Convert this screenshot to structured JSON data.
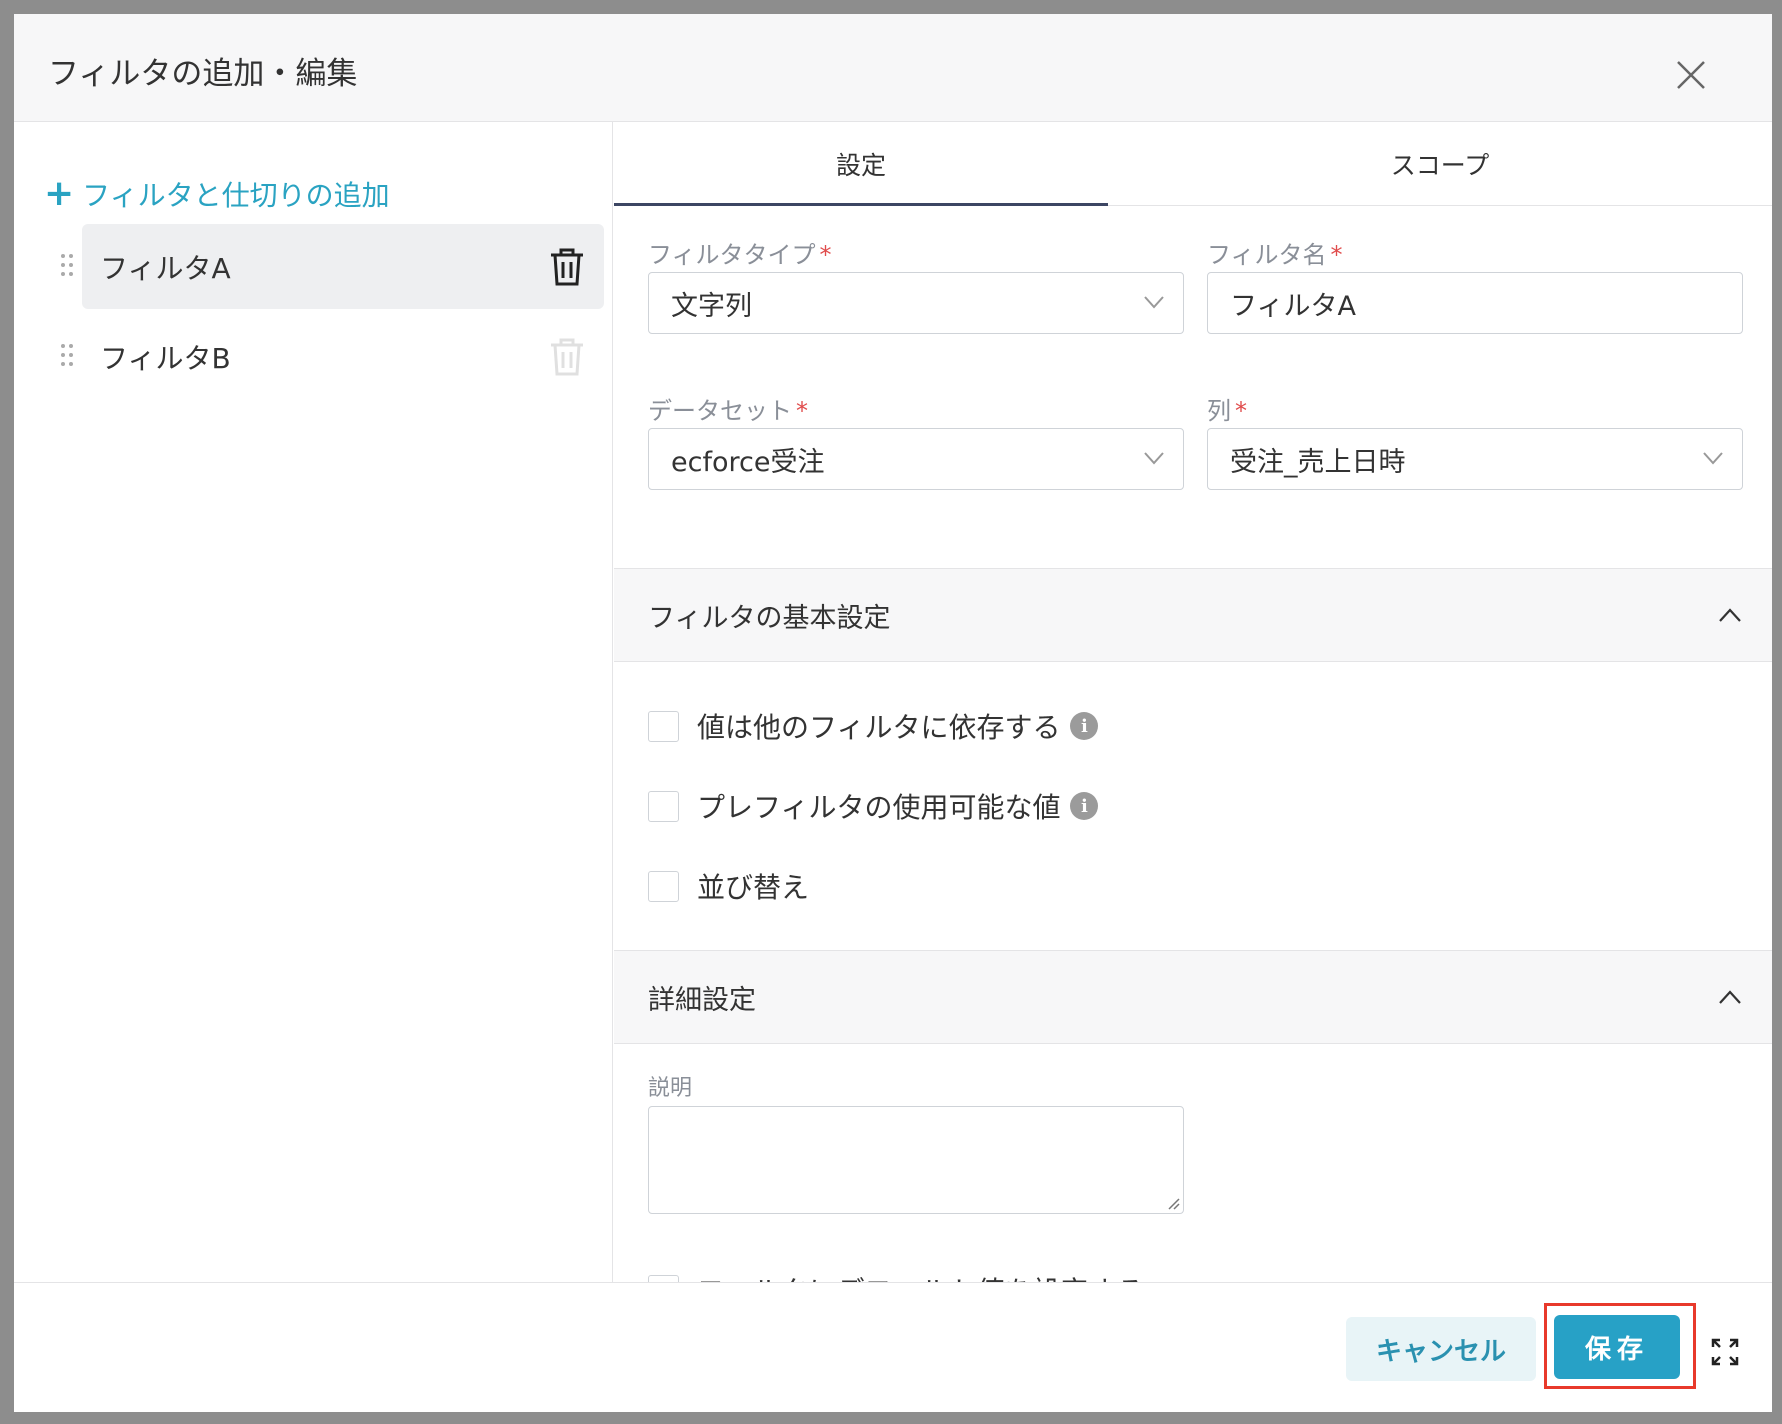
{
  "modal": {
    "title": "フィルタの追加・編集"
  },
  "left": {
    "add_label": "フィルタと仕切りの追加",
    "filters": [
      {
        "label": "フィルタA",
        "active": true
      },
      {
        "label": "フィルタB",
        "active": false
      }
    ]
  },
  "tabs": [
    {
      "label": "設定",
      "active": true
    },
    {
      "label": "スコープ",
      "active": false
    }
  ],
  "form": {
    "filter_type": {
      "label": "フィルタタイプ",
      "value": "文字列"
    },
    "filter_name": {
      "label": "フィルタ名",
      "value": "フィルタA"
    },
    "dataset": {
      "label": "データセット",
      "value": "ecforce受注"
    },
    "column": {
      "label": "列",
      "value": "受注_売上日時"
    },
    "required_mark": "*"
  },
  "basic_section": {
    "title": "フィルタの基本設定",
    "options": [
      {
        "label": "値は他のフィルタに依存する",
        "checked": false,
        "info": true
      },
      {
        "label": "プレフィルタの使用可能な値",
        "checked": false,
        "info": true
      },
      {
        "label": "並び替え",
        "checked": false,
        "info": false
      }
    ]
  },
  "detail_section": {
    "title": "詳細設定",
    "description_label": "説明",
    "description_value": "",
    "default_value_label": "フィルタにデフォルト値を設定する"
  },
  "footer": {
    "cancel_label": "キャンセル",
    "save_label": "保存"
  },
  "colors": {
    "accent": "#27a1c6",
    "highlight": "#e8392b",
    "required": "#e04c4c"
  }
}
